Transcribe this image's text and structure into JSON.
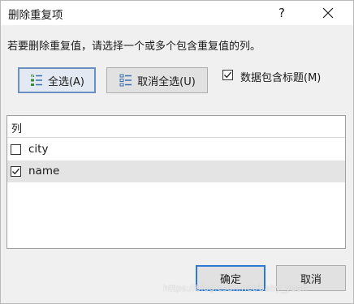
{
  "window": {
    "title": "删除重复项",
    "help_label": "?"
  },
  "instruction": "若要删除重复值，请选择一个或多个包含重复值的列。",
  "buttons": {
    "select_all": "全选(A)",
    "deselect_all": "取消全选(U)",
    "ok": "确定",
    "cancel": "取消"
  },
  "header_checkbox": {
    "label": "数据包含标题(M)",
    "checked": true
  },
  "columns_list": {
    "header": "列",
    "items": [
      {
        "label": "city",
        "checked": false
      },
      {
        "label": "name",
        "checked": true
      }
    ]
  },
  "colors": {
    "dialog_bg": "#f0f0f0",
    "title_bg": "#ffffff",
    "selected_row": "#e4e4e4",
    "default_button_border": "#2a79d3"
  },
  "icons": {
    "close": "close-icon",
    "select_all": "select-all-icon",
    "deselect_all": "deselect-all-icon",
    "check": "check-icon"
  },
  "watermark": "https://blog.csdn.net/baby_yuan"
}
